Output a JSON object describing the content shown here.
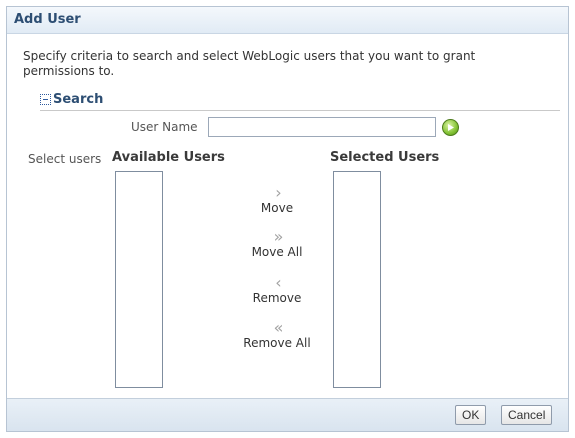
{
  "dialog": {
    "title": "Add User",
    "instructions": "Specify criteria to search and select WebLogic users that you want to grant permissions to."
  },
  "search": {
    "section_title": "Search",
    "user_name_label": "User Name",
    "user_name_value": ""
  },
  "select": {
    "label": "Select users",
    "available_header": "Available Users",
    "selected_header": "Selected Users",
    "available_items": [],
    "selected_items": []
  },
  "shuttle": {
    "move": "Move",
    "move_all": "Move All",
    "remove": "Remove",
    "remove_all": "Remove All"
  },
  "footer": {
    "ok": "OK",
    "cancel": "Cancel"
  },
  "colors": {
    "title_text": "#2d4e73",
    "go_button": "#83c234"
  },
  "icons": {
    "disclosure": "minus-box-icon",
    "go": "go-arrow-icon",
    "move": "chevron-right-icon",
    "move_all": "double-chevron-right-icon",
    "remove": "chevron-left-icon",
    "remove_all": "double-chevron-left-icon"
  }
}
